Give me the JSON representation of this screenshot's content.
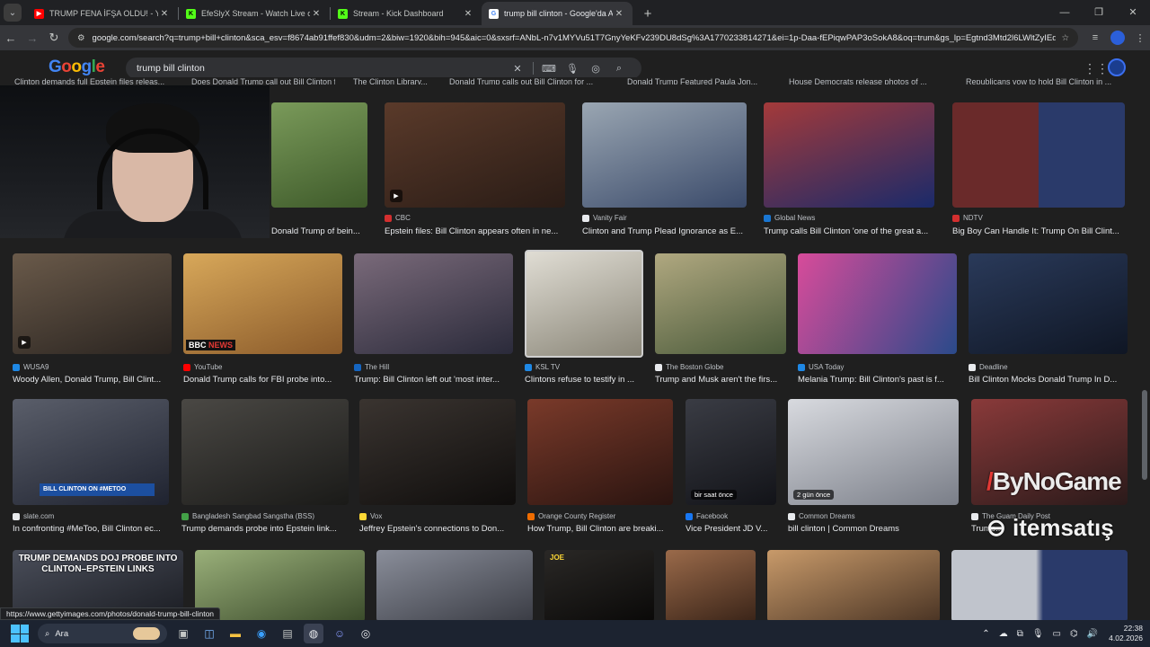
{
  "tabs": [
    {
      "title": "TRUMP FENA İFŞA OLDU! - You",
      "favicon_color": "#ff0000",
      "fav": "▶"
    },
    {
      "title": "EfeSlyX Stream - Watch Live on",
      "favicon_color": "#53fc18",
      "fav": "K"
    },
    {
      "title": "Stream - Kick Dashboard",
      "favicon_color": "#53fc18",
      "fav": "K"
    },
    {
      "title": "trump bill clinton - Google'da A",
      "favicon_color": "#ffffff",
      "fav": "G",
      "active": true
    }
  ],
  "address": {
    "url": "google.com/search?q=trump+bill+clinton&sca_esv=f8674ab91ffef830&udm=2&biw=1920&bih=945&aic=0&sxsrf=ANbL-n7v1MYVu51T7GnyYeKFv239DU8dSg%3A1770233814271&ei=1p-Daa-fEPiqwPAP3oSokA8&oq=trum&gs_lp=Egtnd3Mtd2l6LWltZyIEd..."
  },
  "google": {
    "logo": "Google",
    "query": "trump bill clinton"
  },
  "cut_captions": [
    "Clinton demands full Epstein files releas...",
    "Does Donald Trump call out Bill Clinton f...",
    "The Clinton Library...",
    "Donald Trump calls out Bill Clinton for ...",
    "Donald Trump Featured Paula Jon...",
    "House Democrats release photos of ...",
    "Republicans vow to hold Bill Clinton in ..."
  ],
  "rows": [
    [
      {
        "source": "",
        "caption": "Donald Trump of bein...",
        "icon_color": "#fff",
        "thumb": "#4e6b3a",
        "play": false
      },
      {
        "source": "CBC",
        "caption": "Epstein files: Bill Clinton appears often in ne...",
        "icon_color": "#d32f2f",
        "thumb": "#3b2a22",
        "play": true
      },
      {
        "source": "Vanity Fair",
        "caption": "Clinton and Trump Plead Ignorance as E...",
        "icon_color": "#e8eaed",
        "thumb": "#6b7b8c",
        "play": false
      },
      {
        "source": "Global News",
        "caption": "Trump calls Bill Clinton 'one of the great a...",
        "icon_color": "#1976d2",
        "thumb": "#5a2a30",
        "play": false
      },
      {
        "source": "NDTV",
        "caption": "Big Boy Can Handle It: Trump On Bill Clint...",
        "icon_color": "#d32f2f",
        "thumb": "#5b2b2b",
        "play": false
      }
    ],
    [
      {
        "source": "WUSA9",
        "caption": "Woody Allen, Donald Trump, Bill Clint...",
        "icon_color": "#1e88e5",
        "thumb": "#4a4038",
        "play": true
      },
      {
        "source": "YouTube",
        "caption": "Donald Trump calls for FBI probe into...",
        "icon_color": "#ff0000",
        "thumb": "#b58a3a",
        "play": false
      },
      {
        "source": "The Hill",
        "caption": "Trump: Bill Clinton left out 'most inter...",
        "icon_color": "#1565c0",
        "thumb": "#4a4c5a",
        "play": false
      },
      {
        "source": "KSL TV",
        "caption": "Clintons refuse to testify in ...",
        "icon_color": "#1e88e5",
        "thumb": "#c9c4b8",
        "play": false
      },
      {
        "source": "The Boston Globe",
        "caption": "Trump and Musk aren't the firs...",
        "icon_color": "#e8eaed",
        "thumb": "#6d6a55",
        "play": false
      },
      {
        "source": "USA Today",
        "caption": "Melania Trump: Bill Clinton's past is f...",
        "icon_color": "#1e88e5",
        "thumb": "#3a4f7a",
        "play": false
      },
      {
        "source": "Deadline",
        "caption": "Bill Clinton Mocks Donald Trump In D...",
        "icon_color": "#e8eaed",
        "thumb": "#1f2a3a",
        "play": false
      }
    ],
    [
      {
        "source": "slate.com",
        "caption": "In confronting #MeToo, Bill Clinton ec...",
        "icon_color": "#e8eaed",
        "thumb": "#3b3e48",
        "play": false
      },
      {
        "source": "Bangladesh Sangbad Sangstha (BSS)",
        "caption": "Trump demands probe into Epstein link...",
        "icon_color": "#43a047",
        "thumb": "#3c3a36",
        "play": false
      },
      {
        "source": "Vox",
        "caption": "Jeffrey Epstein's connections to Don...",
        "icon_color": "#fdd835",
        "thumb": "#2a2622",
        "play": false
      },
      {
        "source": "Orange County Register",
        "caption": "How Trump, Bill Clinton are breaki...",
        "icon_color": "#ef6c00",
        "thumb": "#4a2a24",
        "play": false
      },
      {
        "source": "Facebook",
        "caption": "Vice President JD V...",
        "icon_color": "#1877f2",
        "thumb": "#25272c",
        "play": false,
        "badge": "bir saat önce"
      },
      {
        "source": "Common Dreams",
        "caption": "bill clinton | Common Dreams",
        "icon_color": "#e8eaed",
        "thumb": "#c2c4c8",
        "play": false,
        "badge": "2 gün önce"
      },
      {
        "source": "The Guam Daily Post",
        "caption": "Trump...",
        "icon_color": "#e8eaed",
        "thumb": "#6a2a2a",
        "play": false
      }
    ],
    [
      {
        "thumb": "#3a3e49",
        "banner": "TRUMP DEMANDS DOJ PROBE INTO CLINTON–EPSTEIN LINKS"
      },
      {
        "thumb": "#617a4c"
      },
      {
        "thumb": "#5a5e6a"
      },
      {
        "thumb": "#2c2a28",
        "banner": "JOE"
      },
      {
        "thumb": "#5a3a2a"
      },
      {
        "thumb": "#6a5a4a"
      },
      {
        "thumb": "#3c4a6a"
      }
    ]
  ],
  "watermarks": {
    "one": "ByNoGame",
    "two": "itemsatış"
  },
  "status_url": "https://www.gettyimages.com/photos/donald-trump-bill-clinton",
  "taskbar": {
    "search_label": "Ara",
    "time": "22:38",
    "date": "4.02.2026"
  }
}
